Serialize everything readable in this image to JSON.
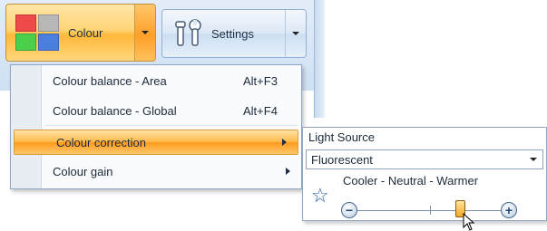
{
  "ribbon": {
    "colour_button": {
      "label": "Colour",
      "swatch_colors": [
        "#ef4a4a",
        "#b8b8b8",
        "#4ccf4c",
        "#4a7fe0"
      ]
    },
    "settings_button": {
      "label": "Settings"
    }
  },
  "menu": {
    "items": [
      {
        "label": "Colour balance - Area",
        "shortcut": "Alt+F3"
      },
      {
        "label": "Colour balance - Global",
        "shortcut": "Alt+F4"
      },
      {
        "label": "Colour correction",
        "shortcut": "",
        "submenu": true,
        "active": true
      },
      {
        "label": "Colour gain",
        "shortcut": "",
        "submenu": true
      }
    ]
  },
  "submenu": {
    "title": "Light Source",
    "select_value": "Fluorescent",
    "slider_label": "Cooler - Neutral - Warmer",
    "slider_value": 0.74,
    "minus_glyph": "−",
    "plus_glyph": "+",
    "star_icon": "☆"
  },
  "colors": {
    "accent_orange": "#ffb845",
    "border_blue": "#8fa6c5",
    "star_blue": "#2a5fa8"
  }
}
